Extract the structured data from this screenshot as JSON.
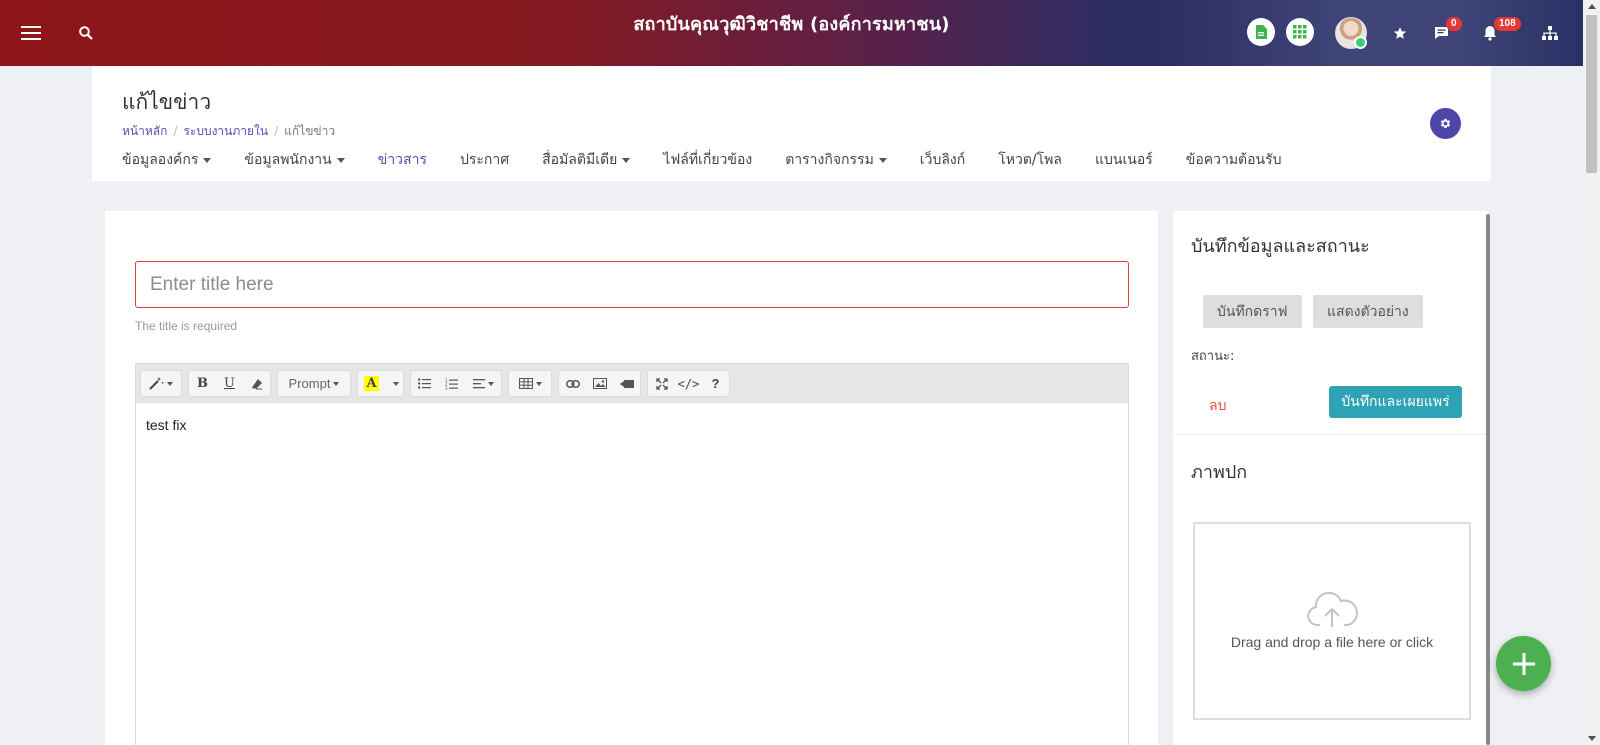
{
  "header": {
    "org_title": "สถาบันคุณวุฒิวิชาชีพ (องค์การมหาชน)",
    "chat_badge": "0",
    "notification_badge": "108",
    "colors": {
      "brand_red": "#8e1517",
      "brand_navy": "#293068"
    }
  },
  "page": {
    "title": "แก้ไขข่าว",
    "breadcrumb": [
      "หน้าหลัก",
      "ระบบงานภายใน",
      "แก้ไขข่าว"
    ]
  },
  "nav": {
    "items": [
      {
        "label": "ข้อมูลองค์กร"
      },
      {
        "label": "ข้อมูลพนักงาน"
      },
      {
        "label": "ข่าวสาร"
      },
      {
        "label": "ประกาศ"
      },
      {
        "label": "สื่อมัลติมีเดีย"
      },
      {
        "label": "ไฟล์ที่เกี่ยวข้อง"
      },
      {
        "label": "ตารางกิจกรรม"
      },
      {
        "label": "เว็บลิงก์"
      },
      {
        "label": "โหวต/โพล"
      },
      {
        "label": "แบนเนอร์"
      },
      {
        "label": "ข้อความต้อนรับ"
      }
    ],
    "active": "ข่าวสาร"
  },
  "editor": {
    "title_placeholder": "Enter title here",
    "title_value": "",
    "title_help": "The title is required",
    "style_dropdown": "Prompt",
    "content": "test fix"
  },
  "sidebar": {
    "save_section_title": "บันทึกข้อมูลและสถานะ",
    "save_draft_label": "บันทึกดราฟ",
    "preview_label": "แสดงตัวอย่าง",
    "status_label": "สถานะ:",
    "delete_label": "ลบ",
    "publish_label": "บันทึกและเผยแพร่",
    "cover_title": "ภาพปก",
    "dropzone_text": "Drag and drop a file here or click"
  }
}
